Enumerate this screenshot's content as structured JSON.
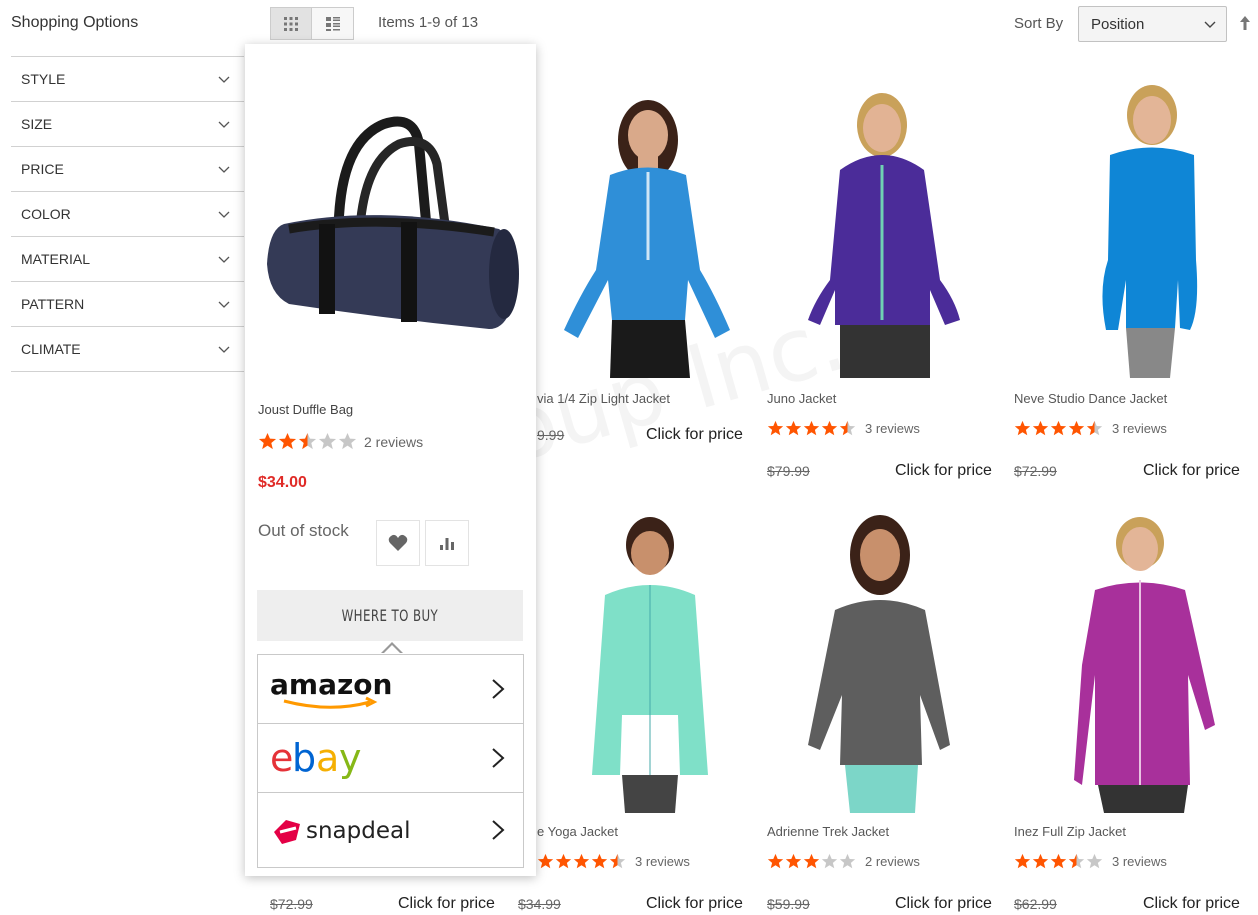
{
  "sidebar": {
    "title": "Shopping Options",
    "filters": [
      "STYLE",
      "SIZE",
      "PRICE",
      "COLOR",
      "MATERIAL",
      "PATTERN",
      "CLIMATE"
    ]
  },
  "toolbar": {
    "grid_icon": "grid-view-icon",
    "list_icon": "list-view-icon",
    "items_count": "Items 1-9 of 13",
    "sort_label": "Sort By",
    "sort_value": "Position",
    "sort_direction_icon": "arrow-up-icon"
  },
  "watermark": "V Group Inc.",
  "popup": {
    "name": "Joust Duffle Bag",
    "rating_stars": 2.5,
    "reviews": "2 reviews",
    "price": "$34.00",
    "stock": "Out of stock",
    "wishlist_icon": "heart-icon",
    "compare_icon": "compare-icon",
    "where_to_buy": "WHERE TO BUY",
    "stores": [
      {
        "name": "amazon",
        "logo": "amazon-logo"
      },
      {
        "name": "ebay",
        "logo": "ebay-logo"
      },
      {
        "name": "snapdeal",
        "logo": "snapdeal-logo"
      }
    ]
  },
  "products": [
    {
      "name": "via 1/4 Zip Light Jacket",
      "old_price": "9.99",
      "click": "Click for price"
    },
    {
      "name": "Juno Jacket",
      "rating_stars": 4.5,
      "reviews": "3 reviews",
      "old_price": "$79.99",
      "click": "Click for price"
    },
    {
      "name": "Neve Studio Dance Jacket",
      "rating_stars": 4.5,
      "reviews": "3 reviews",
      "old_price": "$72.99",
      "click": "Click for price"
    },
    {
      "name": "e Yoga Jacket",
      "rating_stars": 4.5,
      "reviews": "3 reviews",
      "old_price": "$34.99",
      "click": "Click for price"
    },
    {
      "name": "Adrienne Trek Jacket",
      "rating_stars": 3,
      "reviews": "2 reviews",
      "old_price": "$59.99",
      "click": "Click for price"
    },
    {
      "name": "Inez Full Zip Jacket",
      "rating_stars": 3.5,
      "reviews": "3 reviews",
      "old_price": "$62.99",
      "click": "Click for price"
    }
  ],
  "bottom_row_first": {
    "old_price": "$72.99",
    "click": "Click for price"
  },
  "colors": {
    "star_filled": "#ff5501",
    "star_empty": "#c7c7c7",
    "price_red": "#e02b27"
  }
}
